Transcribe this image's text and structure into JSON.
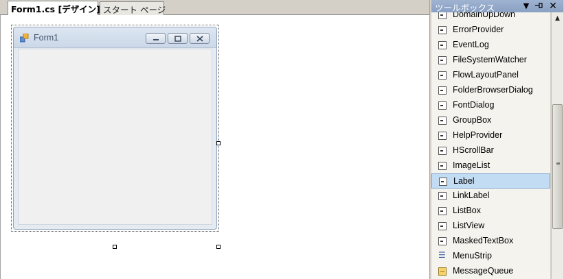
{
  "designer": {
    "tabs": [
      {
        "label": "Form1.cs [デザイン]",
        "active": true
      },
      {
        "label": "スタート ページ",
        "active": false
      }
    ],
    "form": {
      "title": "Form1"
    }
  },
  "toolbox": {
    "title": "ツールボックス",
    "items": [
      {
        "label": "DomainUpDown",
        "icon": "control-icon"
      },
      {
        "label": "ErrorProvider",
        "icon": "control-icon"
      },
      {
        "label": "EventLog",
        "icon": "control-icon"
      },
      {
        "label": "FileSystemWatcher",
        "icon": "control-icon"
      },
      {
        "label": "FlowLayoutPanel",
        "icon": "control-icon"
      },
      {
        "label": "FolderBrowserDialog",
        "icon": "control-icon"
      },
      {
        "label": "FontDialog",
        "icon": "control-icon"
      },
      {
        "label": "GroupBox",
        "icon": "control-icon"
      },
      {
        "label": "HelpProvider",
        "icon": "control-icon"
      },
      {
        "label": "HScrollBar",
        "icon": "control-icon"
      },
      {
        "label": "ImageList",
        "icon": "control-icon"
      },
      {
        "label": "Label",
        "icon": "control-icon",
        "selected": true
      },
      {
        "label": "LinkLabel",
        "icon": "control-icon"
      },
      {
        "label": "ListBox",
        "icon": "control-icon"
      },
      {
        "label": "ListView",
        "icon": "control-icon"
      },
      {
        "label": "MaskedTextBox",
        "icon": "control-icon"
      },
      {
        "label": "MenuStrip",
        "icon": "menu-strip-icon"
      },
      {
        "label": "MessageQueue",
        "icon": "message-queue-icon"
      }
    ]
  },
  "colors": {
    "toolbox_header": "#8aa0c3",
    "selected_item": "#c1dcf3",
    "form_title_text": "#40526b"
  }
}
